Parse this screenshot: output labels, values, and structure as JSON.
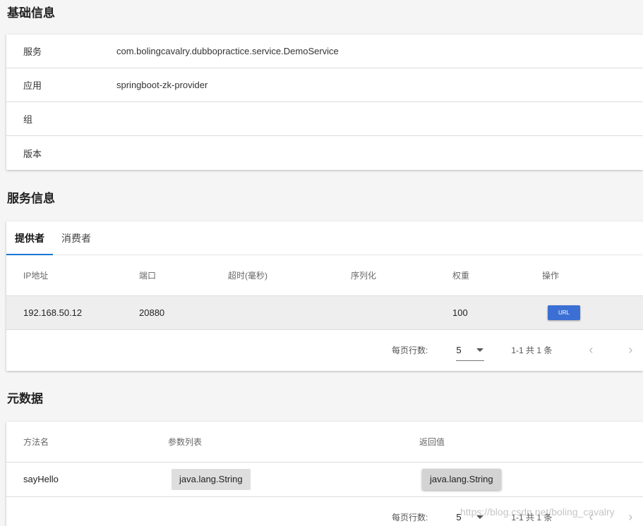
{
  "basic_info": {
    "title": "基础信息",
    "rows": [
      {
        "key": "服务",
        "value": "com.bolingcavalry.dubbopractice.service.DemoService"
      },
      {
        "key": "应用",
        "value": "springboot-zk-provider"
      },
      {
        "key": "组",
        "value": ""
      },
      {
        "key": "版本",
        "value": ""
      }
    ]
  },
  "service_info": {
    "title": "服务信息",
    "tabs": [
      "提供者",
      "消费者"
    ],
    "active_tab": "提供者",
    "columns": [
      "IP地址",
      "端口",
      "超时(毫秒)",
      "序列化",
      "权重",
      "操作"
    ],
    "rows": [
      {
        "ip": "192.168.50.12",
        "port": "20880",
        "timeout": "",
        "serialization": "",
        "weight": "100",
        "action": "URL"
      }
    ],
    "pager": {
      "rows_label": "每页行数:",
      "rows_value": "5",
      "range": "1-1 共 1 条"
    }
  },
  "metadata": {
    "title": "元数据",
    "columns": [
      "方法名",
      "参数列表",
      "返回值"
    ],
    "rows": [
      {
        "method": "sayHello",
        "params": "java.lang.String",
        "return": "java.lang.String"
      }
    ],
    "pager": {
      "rows_label": "每页行数:",
      "rows_value": "5",
      "range": "1-1 共 1 条"
    }
  },
  "watermark": "https://blog.csdn.net/boling_cavalry",
  "colors": {
    "accent": "#1976d2",
    "url_button": "#3b6fd4",
    "page_bg": "#f5f5f5"
  }
}
